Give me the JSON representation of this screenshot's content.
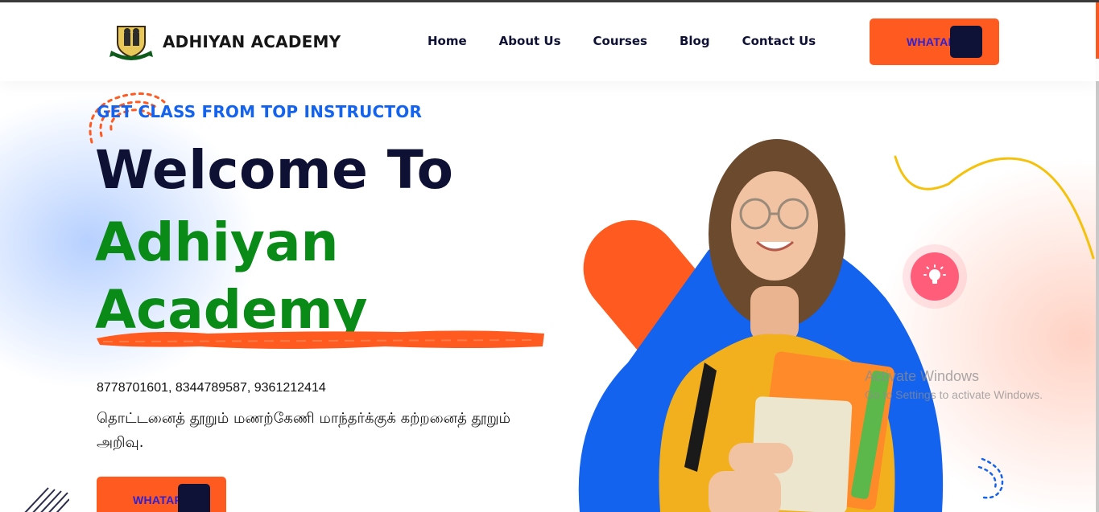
{
  "header": {
    "brand": "ADHIYAN ACADEMY",
    "logo_icon": "academy-emblem-icon",
    "nav": [
      "Home",
      "About Us",
      "Courses",
      "Blog",
      "Contact Us"
    ],
    "cta_label": "WHATAPP"
  },
  "hero": {
    "tagline": "GET CLASS FROM TOP INSTRUCTOR",
    "title_line1": "Welcome To",
    "title_line2": "Adhiyan",
    "title_line3": "Academy",
    "phones": "8778701601, 8344789587, 9361212414",
    "quote": "தொட்டனைத் தூறும் மணற்கேணி மாந்தர்க்குக் கற்றனைத் தூறும் அறிவு.",
    "cta_label": "WHATAPP",
    "bulb_icon": "lightbulb-icon"
  },
  "colors": {
    "accent_orange": "#ff5a1f",
    "brand_blue": "#1463ee",
    "heading_navy": "#0e1133",
    "brand_green": "#0a8a17",
    "bulb_pink": "#ff5d7a"
  },
  "system": {
    "watermark_title": "Activate Windows",
    "watermark_sub": "Go to Settings to activate Windows."
  }
}
